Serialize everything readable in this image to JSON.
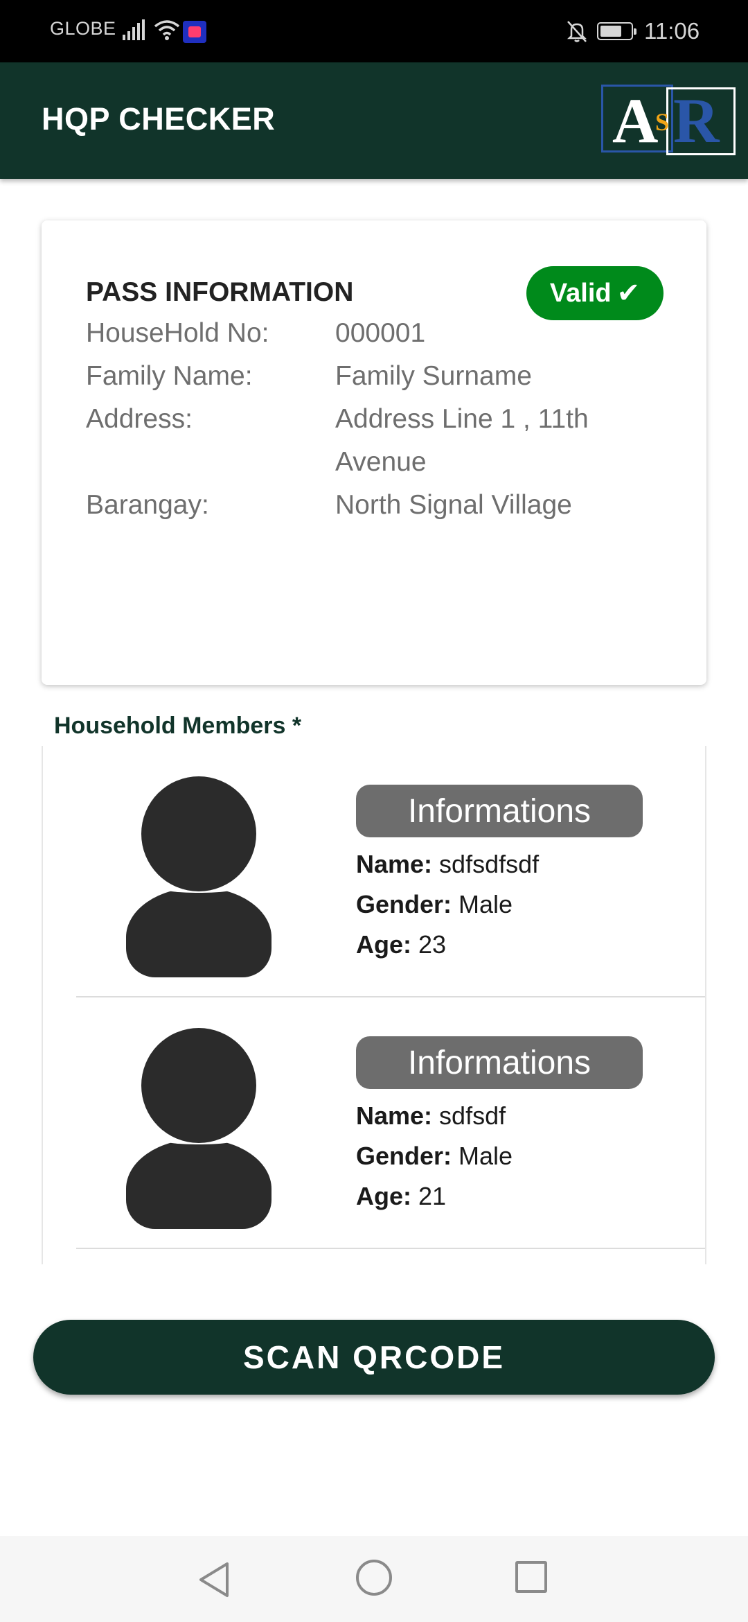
{
  "status_bar": {
    "carrier": "GLOBE",
    "time": "11:06",
    "icons": [
      "signal-icon",
      "wifi-icon",
      "lazada-app-icon",
      "bell-off-icon",
      "battery-icon"
    ]
  },
  "app_bar": {
    "title": "HQP CHECKER",
    "logo": {
      "letters": [
        "A",
        "S",
        "R"
      ],
      "colors": {
        "a": "#ffffff",
        "s": "#f0a417",
        "r": "#2a56a8"
      }
    }
  },
  "pass": {
    "heading": "PASS INFORMATION",
    "status_label": "Valid",
    "status_icon": "✔",
    "status_color": "#008a1b",
    "fields": [
      {
        "label": "HouseHold No:",
        "value": "000001"
      },
      {
        "label": "Family Name:",
        "value": "Family Surname"
      },
      {
        "label": "Address:",
        "value": "Address Line 1 , 11th Avenue"
      },
      {
        "label": "Barangay:",
        "value": "North Signal Village"
      }
    ]
  },
  "members": {
    "title": "Household Members *",
    "info_header": "Informations",
    "labels": {
      "name": "Name:",
      "gender": "Gender:",
      "age": "Age:"
    },
    "items": [
      {
        "name": "sdfsdfsdf",
        "gender": "Male",
        "age": "23"
      },
      {
        "name": "sdfsdf",
        "gender": "Male",
        "age": "21"
      }
    ]
  },
  "scan_button": {
    "label": "SCAN QRCODE"
  },
  "colors": {
    "primary": "#11342a",
    "pill": "#6d6d6d"
  }
}
